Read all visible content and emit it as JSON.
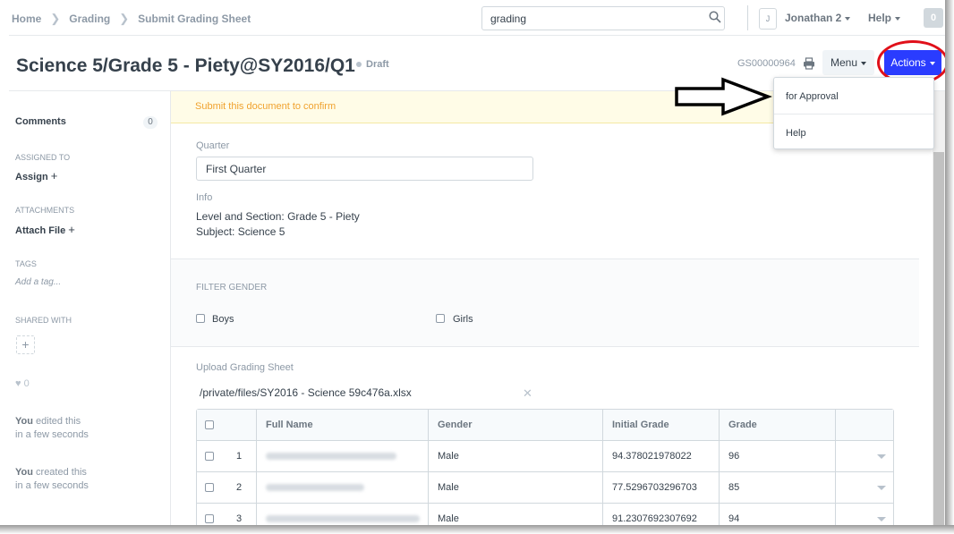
{
  "breadcrumb": [
    "Home",
    "Grading",
    "Submit Grading Sheet"
  ],
  "search": {
    "value": "grading"
  },
  "user": {
    "avatar": "J",
    "name": "Jonathan 2"
  },
  "help": "Help",
  "notifications": "0",
  "document": {
    "title": "Science 5/Grade 5 - Piety@SY2016/Q1",
    "status": "Draft",
    "id": "GS00000964"
  },
  "toolbar": {
    "menu": "Menu",
    "actions": "Actions"
  },
  "actions_menu": [
    "for Approval",
    "Help"
  ],
  "alert": "Submit this document to confirm",
  "sidebar": {
    "comments": "Comments",
    "comments_count": "0",
    "assigned_to": "ASSIGNED TO",
    "assign": "Assign",
    "attachments": "ATTACHMENTS",
    "attach_file": "Attach File",
    "tags": "TAGS",
    "add_tag": "Add a tag...",
    "shared_with": "SHARED WITH",
    "likes": "0",
    "activity": [
      {
        "who": "You",
        "what": " edited this",
        "when": "in a few seconds"
      },
      {
        "who": "You",
        "what": " created this",
        "when": "in a few seconds"
      }
    ]
  },
  "form": {
    "quarter_label": "Quarter",
    "quarter_value": "First Quarter",
    "info_label": "Info",
    "info_line1": "Level and Section: Grade 5 - Piety",
    "info_line2": "Subject: Science 5",
    "filter_label": "FILTER GENDER",
    "boys": "Boys",
    "girls": "Girls",
    "upload_label": "Upload Grading Sheet",
    "file_path": "/private/files/SY2016 - Science 59c476a.xlsx"
  },
  "table": {
    "headers": [
      "Full Name",
      "Gender",
      "Initial Grade",
      "Grade"
    ],
    "rows": [
      {
        "idx": "1",
        "gender": "Male",
        "initial": "94.378021978022",
        "grade": "96"
      },
      {
        "idx": "2",
        "gender": "Male",
        "initial": "77.5296703296703",
        "grade": "85"
      },
      {
        "idx": "3",
        "gender": "Male",
        "initial": "91.2307692307692",
        "grade": "94"
      }
    ]
  },
  "colors": {
    "primary": "#2a3cff",
    "annotation": "#e0101a",
    "alert_text": "#f0a22e"
  }
}
